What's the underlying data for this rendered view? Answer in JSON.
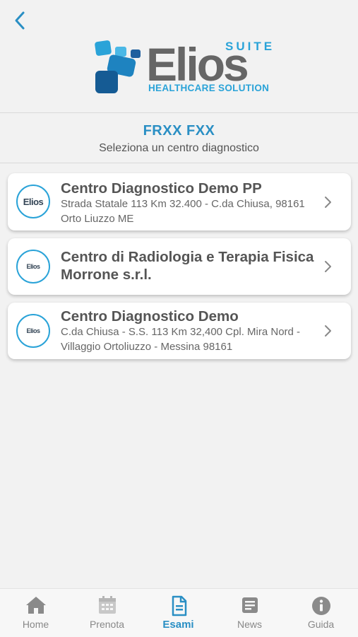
{
  "header": {
    "logo": {
      "suite": "SUITE",
      "wordmark": "Elios",
      "tagline": "HEALTHCARE SOLUTION"
    },
    "user_name": "FRXX FXX",
    "subtitle": "Seleziona un centro diagnostico",
    "back_icon": "chevron-left-icon"
  },
  "centers": [
    {
      "name": "Centro Diagnostico Demo PP",
      "address": "Strada Statale 113 Km 32.400 - C.da Chiusa, 98161 Orto Liuzzo ME",
      "logo_text": "Elios"
    },
    {
      "name": "Centro di Radiologia e Terapia Fisica Morrone s.r.l.",
      "address": "",
      "logo_text": "Elios"
    },
    {
      "name": "Centro Diagnostico Demo",
      "address": "C.da Chiusa - S.S. 113 Km 32,400 Cpl. Mira Nord - Villaggio Ortoliuzzo - Messina 98161",
      "logo_text": "Elios"
    }
  ],
  "tabs": [
    {
      "label": "Home",
      "icon": "home-icon"
    },
    {
      "label": "Prenota",
      "icon": "calendar-icon"
    },
    {
      "label": "Esami",
      "icon": "document-icon",
      "active": true
    },
    {
      "label": "News",
      "icon": "news-icon"
    },
    {
      "label": "Guida",
      "icon": "info-icon"
    }
  ],
  "colors": {
    "accent": "#2a8fc4",
    "brand": "#2aa3d8",
    "tab_inactive": "#888888"
  }
}
